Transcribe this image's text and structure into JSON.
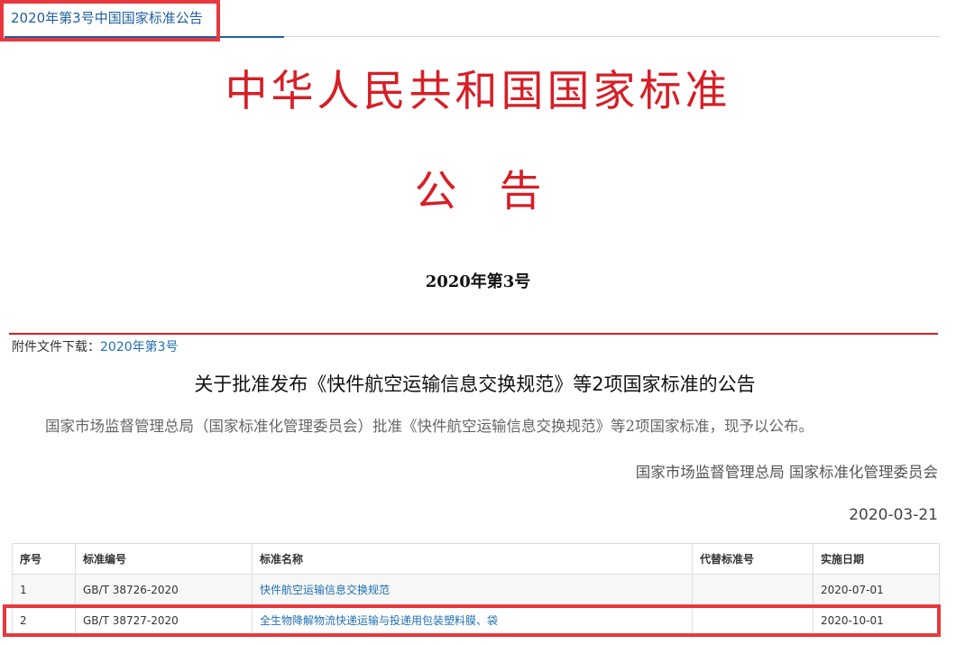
{
  "tab": {
    "label": "2020年第3号中国国家标准公告"
  },
  "document": {
    "heading": "中华人民共和国国家标准",
    "subheading": "公　告",
    "number": "2020年第3号"
  },
  "attachment": {
    "label": "附件文件下载：",
    "link_text": "2020年第3号"
  },
  "announcement": {
    "title": "关于批准发布《快件航空运输信息交换规范》等2项国家标准的公告",
    "body": "国家市场监督管理总局（国家标准化管理委员会）批准《快件航空运输信息交换规范》等2项国家标准，现予以公布。",
    "issuer": "国家市场监督管理总局 国家标准化管理委员会",
    "date": "2020-03-21"
  },
  "table": {
    "headers": [
      "序号",
      "标准编号",
      "标准名称",
      "代替标准号",
      "实施日期"
    ],
    "rows": [
      {
        "index": "1",
        "code": "GB/T 38726-2020",
        "name": "快件航空运输信息交换规范",
        "replaces": "",
        "effective": "2020-07-01"
      },
      {
        "index": "2",
        "code": "GB/T 38727-2020",
        "name": "全生物降解物流快递运输与投递用包装塑料膜、袋",
        "replaces": "",
        "effective": "2020-10-01"
      }
    ]
  },
  "colors": {
    "heading_red": "#d61f26",
    "link_blue": "#1f6fb2",
    "highlight_red": "#e8383d"
  }
}
